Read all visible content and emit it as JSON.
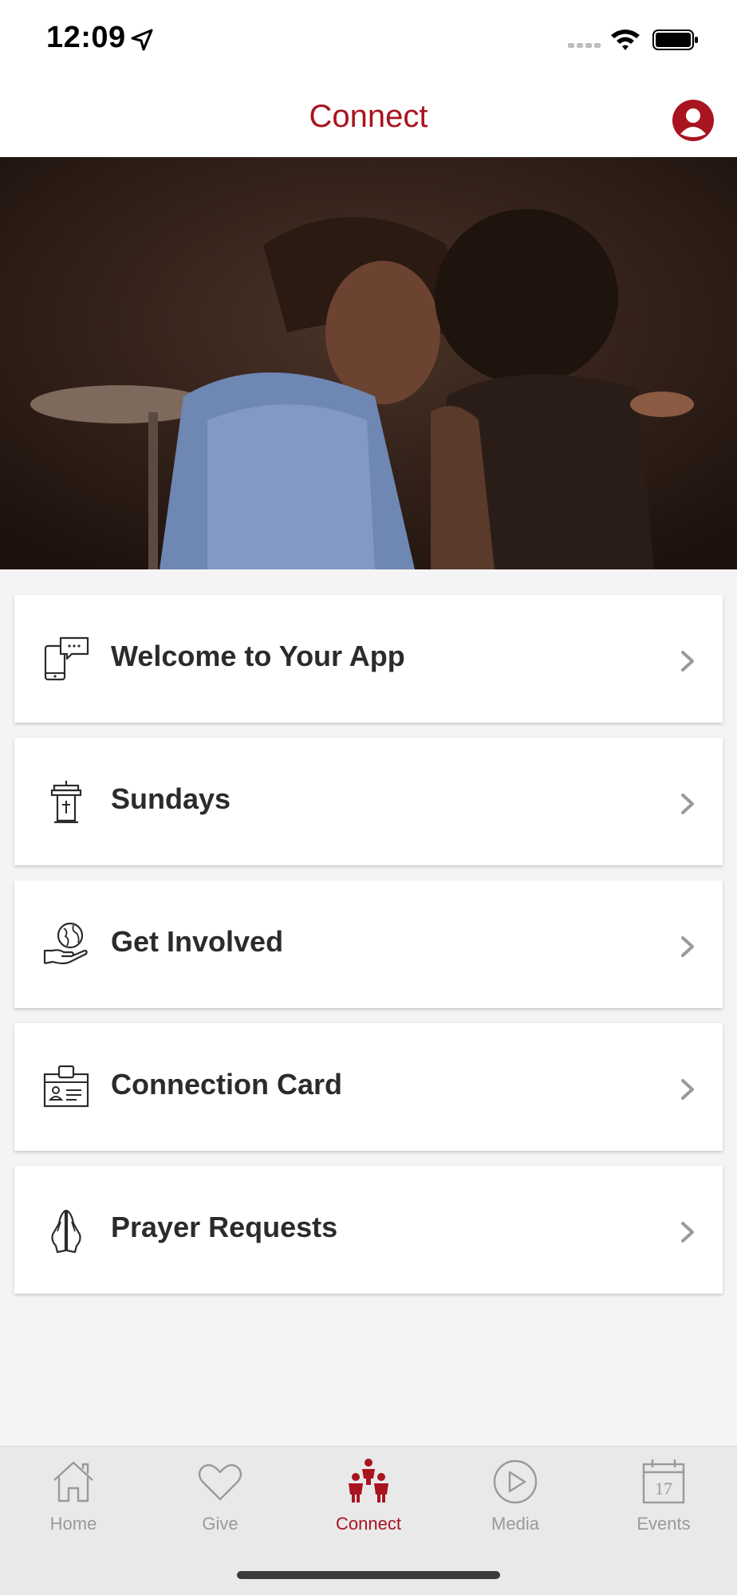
{
  "status_bar": {
    "time": "12:09"
  },
  "nav": {
    "title": "Connect"
  },
  "colors": {
    "accent": "#a8141f",
    "tab_inactive": "#9a9a9a",
    "label_text": "#2b2b2b",
    "background": "#f4f4f4"
  },
  "menu": {
    "items": [
      {
        "label": "Welcome to Your App",
        "icon": "phone-chat-icon"
      },
      {
        "label": "Sundays",
        "icon": "pulpit-icon"
      },
      {
        "label": "Get Involved",
        "icon": "hand-globe-icon"
      },
      {
        "label": "Connection Card",
        "icon": "id-card-icon"
      },
      {
        "label": "Prayer Requests",
        "icon": "praying-hands-icon"
      }
    ]
  },
  "tabs": [
    {
      "label": "Home",
      "icon": "home-icon",
      "active": false
    },
    {
      "label": "Give",
      "icon": "heart-icon",
      "active": false
    },
    {
      "label": "Connect",
      "icon": "people-icon",
      "active": true
    },
    {
      "label": "Media",
      "icon": "play-circle-icon",
      "active": false
    },
    {
      "label": "Events",
      "icon": "calendar-icon",
      "active": false,
      "calendar_day": "17"
    }
  ]
}
